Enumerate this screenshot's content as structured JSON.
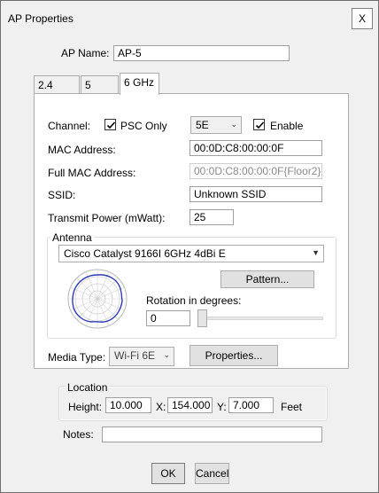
{
  "window": {
    "title": "AP Properties",
    "close_label": "X"
  },
  "ap_name": {
    "label": "AP Name:",
    "value": "AP-5"
  },
  "tabs": [
    {
      "label": "2.4 GHz",
      "active": false
    },
    {
      "label": "5 GHz",
      "active": false
    },
    {
      "label": "6 GHz",
      "active": true
    }
  ],
  "channel": {
    "label": "Channel:",
    "psc_only_label": "PSC Only",
    "psc_only_checked": true,
    "selected": "5E",
    "enable_label": "Enable",
    "enable_checked": true
  },
  "mac": {
    "label": "MAC Address:",
    "value": "00:0D:C8:00:00:0F"
  },
  "full_mac": {
    "label": "Full MAC Address:",
    "value": "00:0D:C8:00:00:0F{Floor2}"
  },
  "ssid": {
    "label": "SSID:",
    "value": "Unknown SSID"
  },
  "power": {
    "label": "Transmit Power (mWatt):",
    "value": "25"
  },
  "antenna": {
    "group_label": "Antenna",
    "selected": "Cisco Catalyst 9166I 6GHz 4dBi E",
    "pattern_button": "Pattern...",
    "rotation_label": "Rotation in degrees:",
    "rotation_value": "0",
    "rotation_slider_fraction": 0
  },
  "media": {
    "label": "Media Type:",
    "selected": "Wi-Fi 6E",
    "properties_button": "Properties..."
  },
  "location": {
    "group_label": "Location",
    "height_label": "Height:",
    "height_value": "10.000",
    "x_label": "X:",
    "x_value": "154.000",
    "y_label": "Y:",
    "y_value": "7.000",
    "unit": "Feet"
  },
  "notes": {
    "label": "Notes:",
    "value": ""
  },
  "buttons": {
    "ok": "OK",
    "cancel": "Cancel"
  },
  "colors": {
    "pattern_line": "#2d3db8",
    "check": "#000000"
  }
}
